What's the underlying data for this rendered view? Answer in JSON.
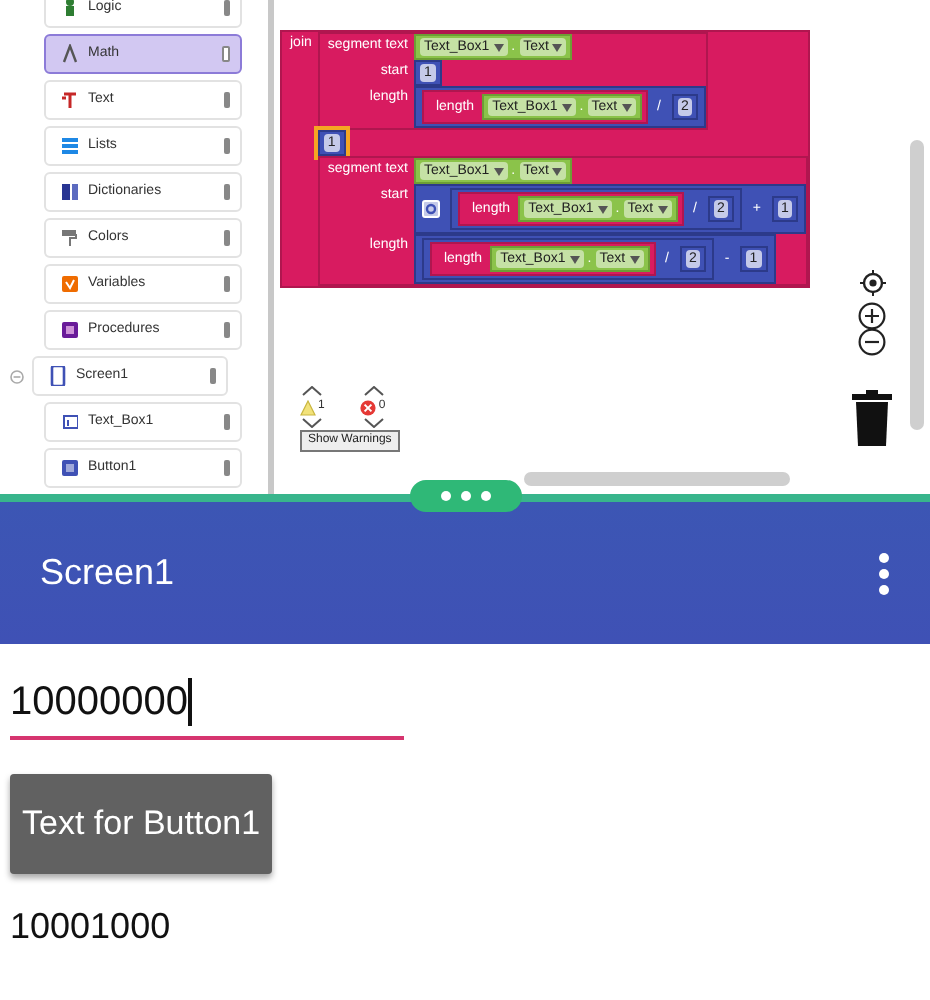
{
  "palette": [
    {
      "label": "Logic",
      "selected": false
    },
    {
      "label": "Math",
      "selected": true
    },
    {
      "label": "Text",
      "selected": false
    },
    {
      "label": "Lists",
      "selected": false
    },
    {
      "label": "Dictionaries",
      "selected": false
    },
    {
      "label": "Colors",
      "selected": false
    },
    {
      "label": "Variables",
      "selected": false
    },
    {
      "label": "Procedures",
      "selected": false
    }
  ],
  "components": [
    {
      "label": "Screen1",
      "kind": "screen",
      "expanded": true,
      "children": [
        {
          "label": "Text_Box1",
          "kind": "textbox"
        },
        {
          "label": "Button1",
          "kind": "button"
        }
      ]
    }
  ],
  "workspace": {
    "blocks": {
      "kind": "text",
      "rows": [
        {
          "label": "join",
          "value": {
            "kind": "text",
            "rows": [
              {
                "label": "segment text",
                "value": {
                  "kind": "getter",
                  "component": "Text_Box1",
                  "separator": ".",
                  "property": "Text"
                }
              },
              {
                "label": "start",
                "value": {
                  "kind": "number",
                  "text": "1",
                  "selected": false
                }
              },
              {
                "label": "length",
                "value": {
                  "kind": "math",
                  "items": [
                    {
                      "kind": "length",
                      "label": "length",
                      "value": {
                        "kind": "getter",
                        "component": "Text_Box1",
                        "separator": ".",
                        "property": "Text"
                      }
                    },
                    {
                      "kind": "op",
                      "text": "/"
                    },
                    {
                      "kind": "number",
                      "text": "2",
                      "selected": false
                    }
                  ]
                }
              }
            ]
          }
        },
        {
          "value": {
            "kind": "number",
            "text": "1",
            "selected": true
          }
        },
        {
          "value": {
            "kind": "text",
            "rows": [
              {
                "label": "segment text",
                "value": {
                  "kind": "getter",
                  "component": "Text_Box1",
                  "separator": ".",
                  "property": "Text"
                }
              },
              {
                "label": "start",
                "value": {
                  "kind": "math",
                  "mutator": true,
                  "items": [
                    {
                      "kind": "math",
                      "items": [
                        {
                          "kind": "length",
                          "label": "length",
                          "value": {
                            "kind": "getter",
                            "component": "Text_Box1",
                            "separator": ".",
                            "property": "Text"
                          }
                        },
                        {
                          "kind": "op",
                          "text": "/"
                        },
                        {
                          "kind": "number",
                          "text": "2",
                          "selected": false
                        }
                      ]
                    },
                    {
                      "kind": "op",
                      "text": "+"
                    },
                    {
                      "kind": "number",
                      "text": "1",
                      "selected": false
                    }
                  ]
                }
              },
              {
                "label": "length",
                "value": {
                  "kind": "math",
                  "items": [
                    {
                      "kind": "math",
                      "items": [
                        {
                          "kind": "length",
                          "label": "length",
                          "value": {
                            "kind": "getter",
                            "component": "Text_Box1",
                            "separator": ".",
                            "property": "Text"
                          }
                        },
                        {
                          "kind": "op",
                          "text": "/"
                        },
                        {
                          "kind": "number",
                          "text": "2",
                          "selected": false
                        }
                      ]
                    },
                    {
                      "kind": "op",
                      "text": "-"
                    },
                    {
                      "kind": "number",
                      "text": "1",
                      "selected": false
                    }
                  ]
                }
              }
            ]
          }
        }
      ]
    },
    "warnings": {
      "warning_count": "1",
      "error_count": "0",
      "toggle_label": "Show Warnings"
    }
  },
  "phone": {
    "title": "Screen1",
    "text_box": {
      "value": "10000000",
      "focused": true
    },
    "button": "Text for Button1",
    "label": "10001000"
  }
}
